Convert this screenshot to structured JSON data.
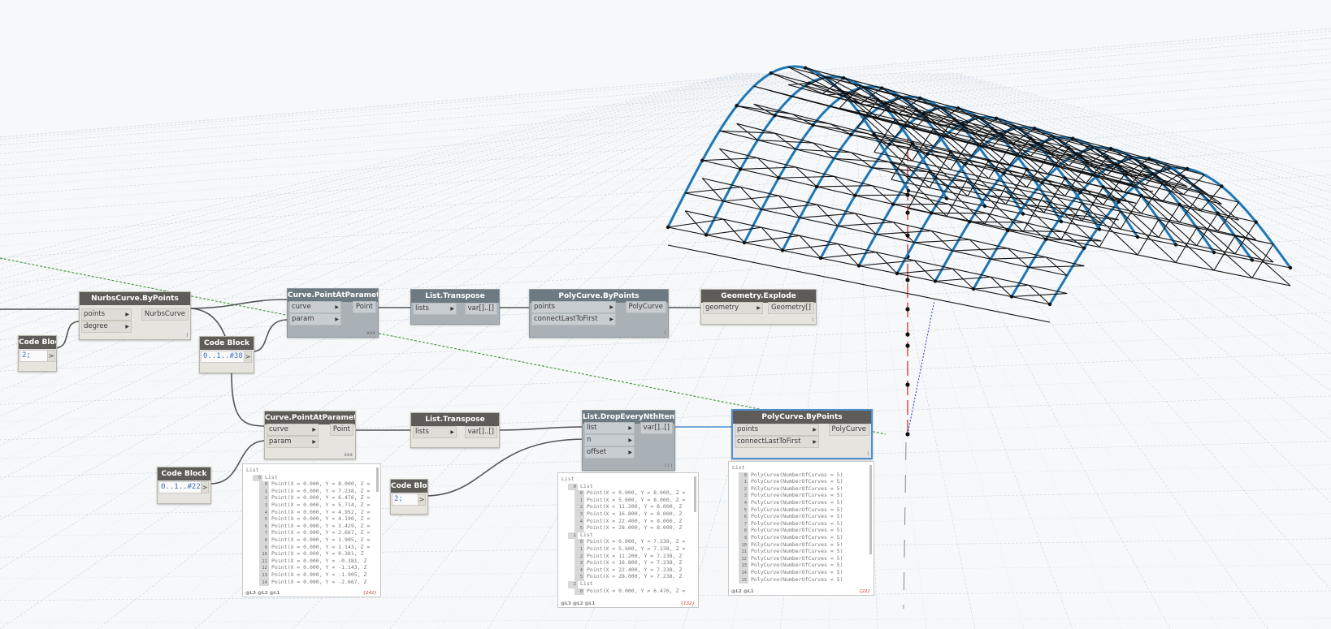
{
  "nodes": {
    "nurbs": {
      "title": "NurbsCurve.ByPoints",
      "in": [
        "points",
        "degree"
      ],
      "out": "NurbsCurve",
      "foot": "l"
    },
    "cb1": {
      "title": "Code Block",
      "code": "2;",
      "out": ">"
    },
    "cb2": {
      "title": "Code Block",
      "code": "0..1..#38;",
      "out": ">"
    },
    "cpap1": {
      "title": "Curve.PointAtParameter",
      "in": [
        "curve",
        "param"
      ],
      "out": "Point",
      "foot": "xxx"
    },
    "lt1": {
      "title": "List.Transpose",
      "in": [
        "lists"
      ],
      "out": "var[]..[]"
    },
    "pcbp1": {
      "title": "PolyCurve.ByPoints",
      "in": [
        "points",
        "connectLastToFirst"
      ],
      "out": "PolyCurve",
      "foot": "l"
    },
    "ge": {
      "title": "Geometry.Explode",
      "in": [
        "geometry"
      ],
      "out": "Geometry[]",
      "foot": "l"
    },
    "cpap2": {
      "title": "Curve.PointAtParameter",
      "in": [
        "curve",
        "param"
      ],
      "out": "Point",
      "foot": "xxx"
    },
    "lt2": {
      "title": "List.Transpose",
      "in": [
        "lists"
      ],
      "out": "var[]..[]"
    },
    "ldrop": {
      "title": "List.DropEveryNthItem",
      "in": [
        "list",
        "n",
        "offset"
      ],
      "out": "var[]..[]",
      "foot": "l l l"
    },
    "pcbp2": {
      "title": "PolyCurve.ByPoints",
      "in": [
        "points",
        "connectLastToFirst"
      ],
      "out": "PolyCurve",
      "foot": "l"
    },
    "cb3": {
      "title": "Code Block",
      "code": "0..1..#22;",
      "out": ">"
    },
    "cb4": {
      "title": "Code Block",
      "code": "2;",
      "out": ">"
    }
  },
  "watches": {
    "w1": {
      "rows": [
        {
          "t": "List",
          "ind": 0
        },
        {
          "t": "List",
          "ind": 1,
          "i": "0"
        },
        {
          "t": "Point(X = 0.000, Y = 8.000, Z =",
          "ind": 2,
          "i": "0"
        },
        {
          "t": "Point(X = 0.000, Y = 7.238, Z =",
          "ind": 2,
          "i": "1"
        },
        {
          "t": "Point(X = 0.000, Y = 6.476, Z =",
          "ind": 2,
          "i": "2"
        },
        {
          "t": "Point(X = 0.000, Y = 5.714, Z =",
          "ind": 2,
          "i": "3"
        },
        {
          "t": "Point(X = 0.000, Y = 4.952, Z =",
          "ind": 2,
          "i": "4"
        },
        {
          "t": "Point(X = 0.000, Y = 4.190, Z =",
          "ind": 2,
          "i": "5"
        },
        {
          "t": "Point(X = 0.000, Y = 3.429, Z =",
          "ind": 2,
          "i": "6"
        },
        {
          "t": "Point(X = 0.000, Y = 2.667, Z =",
          "ind": 2,
          "i": "7"
        },
        {
          "t": "Point(X = 0.000, Y = 1.905, Z =",
          "ind": 2,
          "i": "8"
        },
        {
          "t": "Point(X = 0.000, Y = 1.143, Z =",
          "ind": 2,
          "i": "9"
        },
        {
          "t": "Point(X = 0.000, Y = 0.381, Z",
          "ind": 2,
          "i": "10"
        },
        {
          "t": "Point(X = 0.000, Y = -0.381, Z",
          "ind": 2,
          "i": "11"
        },
        {
          "t": "Point(X = 0.000, Y = -1.143, Z",
          "ind": 2,
          "i": "12"
        },
        {
          "t": "Point(X = 0.000, Y = -1.905, Z",
          "ind": 2,
          "i": "13"
        },
        {
          "t": "Point(X = 0.000, Y = -2.667, Z",
          "ind": 2,
          "i": "14"
        }
      ],
      "levels": "@L3 @L2 @L1",
      "count": "{242}"
    },
    "w2": {
      "rows": [
        {
          "t": "List",
          "ind": 0
        },
        {
          "t": "List",
          "ind": 1,
          "i": "0"
        },
        {
          "t": "Point(X = 0.000, Y = 8.000, Z =",
          "ind": 2,
          "i": "0"
        },
        {
          "t": "Point(X = 5.600, Y = 8.000, Z =",
          "ind": 2,
          "i": "1"
        },
        {
          "t": "Point(X = 11.200, Y = 8.000, Z",
          "ind": 2,
          "i": "2"
        },
        {
          "t": "Point(X = 16.800, Y = 8.000, Z",
          "ind": 2,
          "i": "3"
        },
        {
          "t": "Point(X = 22.400, Y = 8.000, Z",
          "ind": 2,
          "i": "4"
        },
        {
          "t": "Point(X = 28.000, Y = 8.000, Z",
          "ind": 2,
          "i": "5"
        },
        {
          "t": "List",
          "ind": 1,
          "i": "1"
        },
        {
          "t": "Point(X = 0.000, Y = 7.238, Z =",
          "ind": 2,
          "i": "0"
        },
        {
          "t": "Point(X = 5.600, Y = 7.238, Z =",
          "ind": 2,
          "i": "1"
        },
        {
          "t": "Point(X = 11.200, Y = 7.238, Z",
          "ind": 2,
          "i": "2"
        },
        {
          "t": "Point(X = 16.800, Y = 7.238, Z",
          "ind": 2,
          "i": "3"
        },
        {
          "t": "Point(X = 22.400, Y = 7.238, Z",
          "ind": 2,
          "i": "4"
        },
        {
          "t": "Point(X = 28.000, Y = 7.238, Z",
          "ind": 2,
          "i": "5"
        },
        {
          "t": "List",
          "ind": 1,
          "i": "2"
        },
        {
          "t": "Point(X = 0.000, Y = 6.476, Z =",
          "ind": 2,
          "i": "0"
        }
      ],
      "levels": "@L3 @L2 @L1",
      "count": "{132}"
    },
    "w3": {
      "rows": [
        {
          "t": "List",
          "ind": 0
        },
        {
          "t": "PolyCurve(NumberOfCurves = 5)",
          "ind": 1,
          "i": "0"
        },
        {
          "t": "PolyCurve(NumberOfCurves = 5)",
          "ind": 1,
          "i": "1"
        },
        {
          "t": "PolyCurve(NumberOfCurves = 5)",
          "ind": 1,
          "i": "2"
        },
        {
          "t": "PolyCurve(NumberOfCurves = 5)",
          "ind": 1,
          "i": "3"
        },
        {
          "t": "PolyCurve(NumberOfCurves = 5)",
          "ind": 1,
          "i": "4"
        },
        {
          "t": "PolyCurve(NumberOfCurves = 5)",
          "ind": 1,
          "i": "5"
        },
        {
          "t": "PolyCurve(NumberOfCurves = 5)",
          "ind": 1,
          "i": "6"
        },
        {
          "t": "PolyCurve(NumberOfCurves = 5)",
          "ind": 1,
          "i": "7"
        },
        {
          "t": "PolyCurve(NumberOfCurves = 5)",
          "ind": 1,
          "i": "8"
        },
        {
          "t": "PolyCurve(NumberOfCurves = 5)",
          "ind": 1,
          "i": "9"
        },
        {
          "t": "PolyCurve(NumberOfCurves = 5)",
          "ind": 1,
          "i": "10"
        },
        {
          "t": "PolyCurve(NumberOfCurves = 5)",
          "ind": 1,
          "i": "11"
        },
        {
          "t": "PolyCurve(NumberOfCurves = 5)",
          "ind": 1,
          "i": "12"
        },
        {
          "t": "PolyCurve(NumberOfCurves = 5)",
          "ind": 1,
          "i": "13"
        },
        {
          "t": "PolyCurve(NumberOfCurves = 5)",
          "ind": 1,
          "i": "14"
        },
        {
          "t": "PolyCurve(NumberOfCurves = 5)",
          "ind": 1,
          "i": "15"
        }
      ],
      "levels": "@L2 @L1",
      "count": "{22}"
    }
  },
  "colors": {
    "accent": "#1f77b4",
    "wire": "#555555",
    "selected": "#4e8fd0",
    "canvas": "#f7f8f9",
    "grid": "#c9d6e2"
  },
  "icons": {
    "input_port": "triangle-right-icon"
  }
}
